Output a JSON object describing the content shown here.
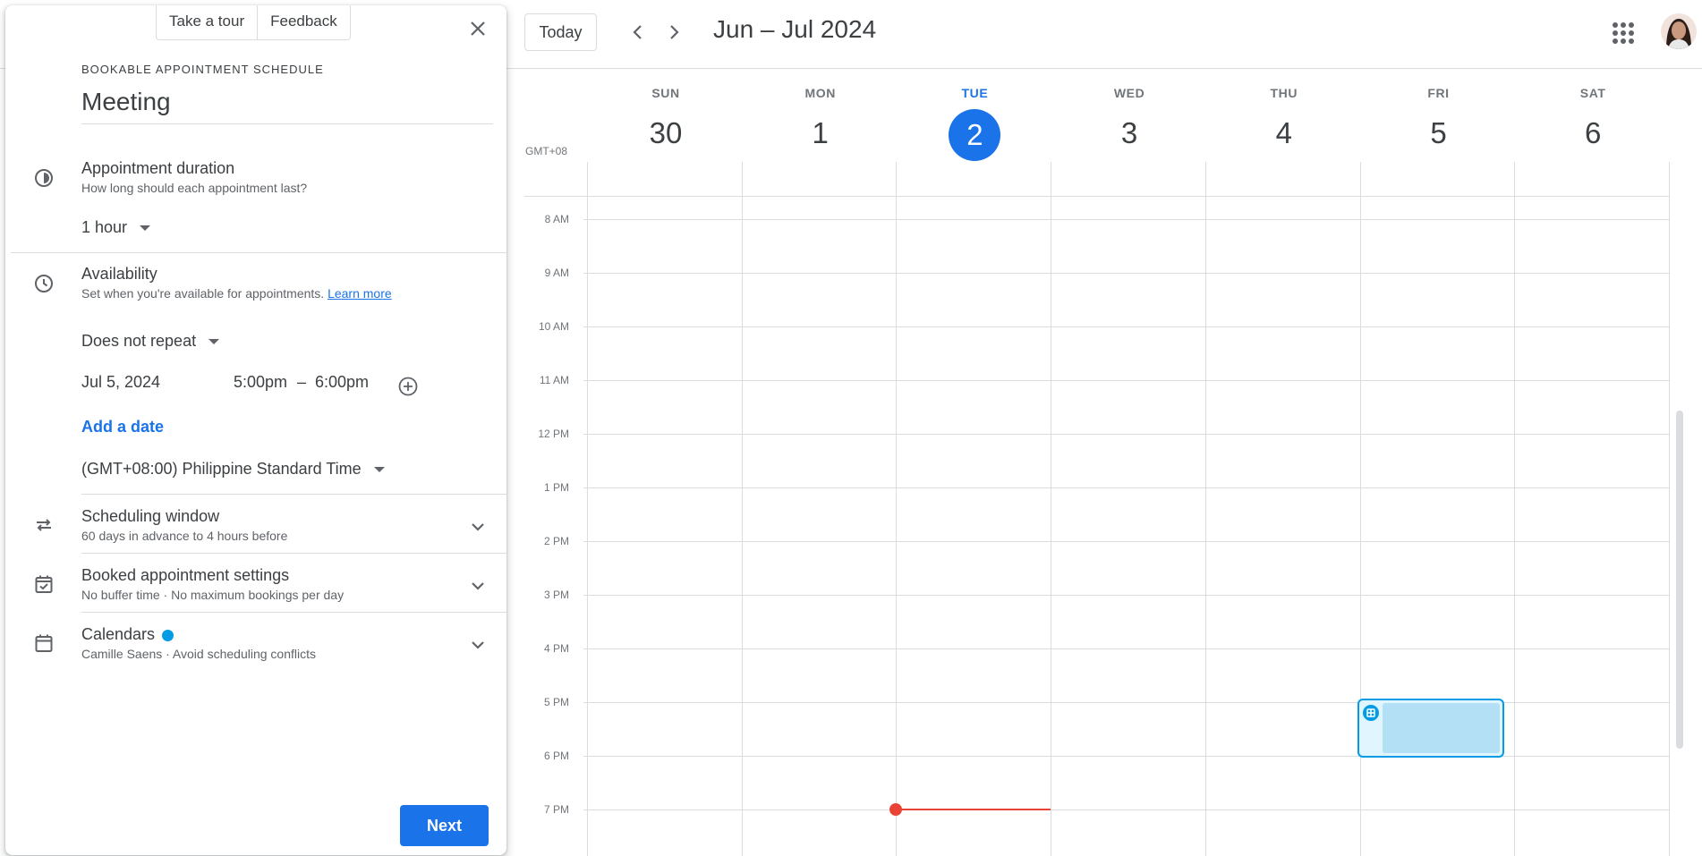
{
  "toolbar": {
    "today_label": "Today",
    "date_range": "Jun – Jul 2024"
  },
  "calendar": {
    "timezone": "GMT+08",
    "days": [
      {
        "name": "SUN",
        "num": "30"
      },
      {
        "name": "MON",
        "num": "1"
      },
      {
        "name": "TUE",
        "num": "2"
      },
      {
        "name": "WED",
        "num": "3"
      },
      {
        "name": "THU",
        "num": "4"
      },
      {
        "name": "FRI",
        "num": "5"
      },
      {
        "name": "SAT",
        "num": "6"
      }
    ],
    "today_index": 2,
    "hours": [
      "8 AM",
      "9 AM",
      "10 AM",
      "11 AM",
      "12 PM",
      "1 PM",
      "2 PM",
      "3 PM",
      "4 PM",
      "5 PM",
      "6 PM",
      "7 PM"
    ],
    "accent_color": "#1a73e8",
    "now_color": "#ea4335",
    "appointment_color": "#039be5"
  },
  "panel": {
    "take_tour": "Take a tour",
    "feedback": "Feedback",
    "kicker": "BOOKABLE APPOINTMENT SCHEDULE",
    "title_value": "Meeting",
    "duration": {
      "title": "Appointment duration",
      "subtitle": "How long should each appointment last?",
      "value": "1 hour"
    },
    "availability": {
      "title": "Availability",
      "subtitle": "Set when you're available for appointments.",
      "learn_more": "Learn more",
      "repeat": "Does not repeat",
      "date": "Jul 5, 2024",
      "start": "5:00pm",
      "dash": "–",
      "end": "6:00pm",
      "add_date": "Add a date",
      "timezone": "(GMT+08:00) Philippine Standard Time"
    },
    "scheduling_window": {
      "title": "Scheduling window",
      "subtitle": "60 days in advance to 4 hours before"
    },
    "booked_settings": {
      "title": "Booked appointment settings",
      "subtitle": "No buffer time · No maximum bookings per day"
    },
    "calendars": {
      "title": "Calendars",
      "subtitle": "Camille Saens · Avoid scheduling conflicts"
    },
    "next_label": "Next"
  }
}
